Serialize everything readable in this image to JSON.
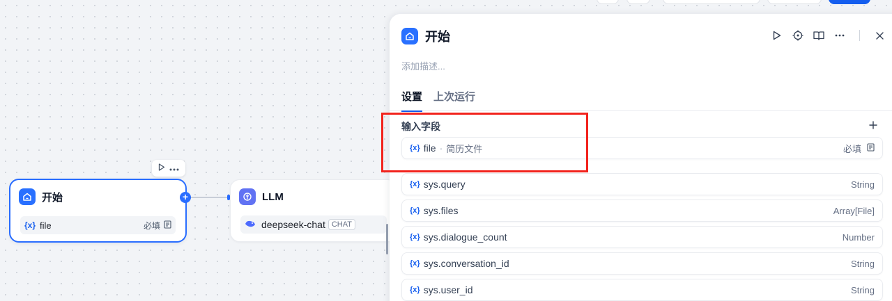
{
  "canvas": {
    "start_node": {
      "title": "开始",
      "variable": "file",
      "required_label": "必填"
    },
    "llm_node": {
      "title": "LLM",
      "model": "deepseek-chat",
      "model_tag": "CHAT"
    }
  },
  "panel": {
    "title": "开始",
    "description_placeholder": "添加描述...",
    "tabs": [
      {
        "label": "设置",
        "active": true
      },
      {
        "label": "上次运行",
        "active": false
      }
    ],
    "section_title": "输入字段",
    "input_field": {
      "name": "file",
      "separator": "·",
      "label": "简历文件",
      "required_label": "必填"
    },
    "system_vars": [
      {
        "name": "sys.query",
        "type": "String"
      },
      {
        "name": "sys.files",
        "type": "Array[File]"
      },
      {
        "name": "sys.dialogue_count",
        "type": "Number"
      },
      {
        "name": "sys.conversation_id",
        "type": "String"
      },
      {
        "name": "sys.user_id",
        "type": "String"
      }
    ]
  },
  "icons": {
    "var_glyph": "{x}",
    "node_start": "home-icon",
    "node_llm": "brain-icon",
    "model_logo": "deepseek-whale-icon"
  },
  "colors": {
    "accent": "#155eef",
    "highlight_box": "#f2231d",
    "start_icon_bg": "#2970ff",
    "llm_icon_bg": "#6172f3"
  }
}
